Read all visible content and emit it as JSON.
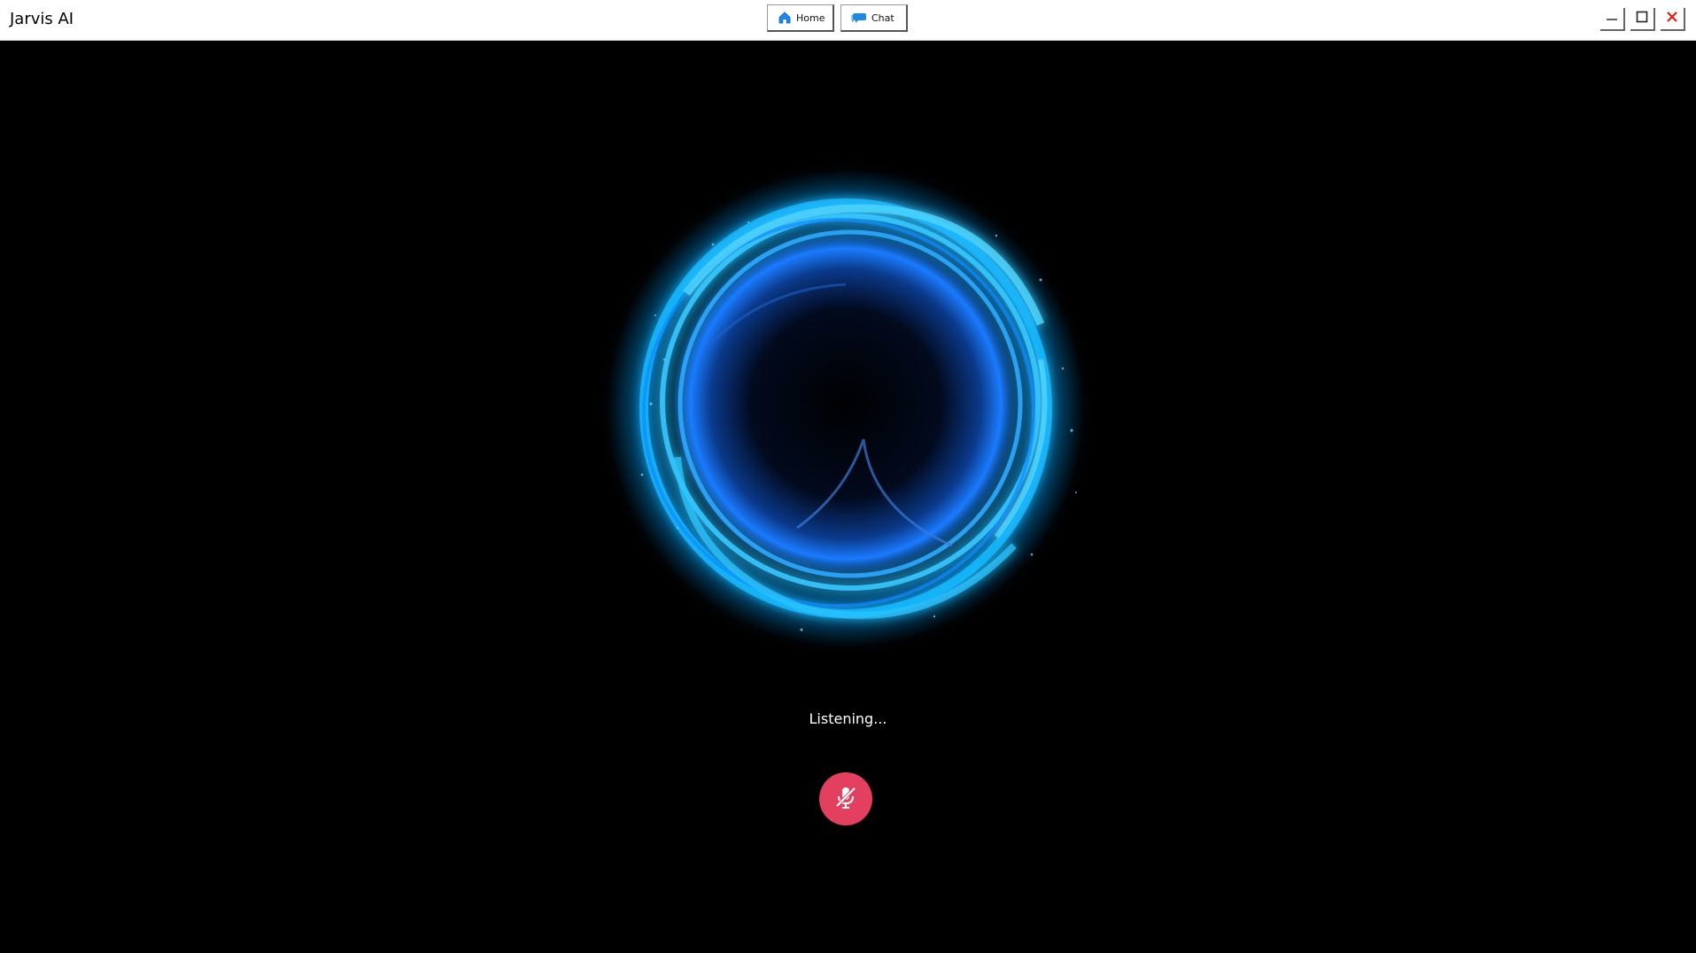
{
  "window": {
    "title": "Jarvis AI"
  },
  "nav": {
    "home_label": "Home",
    "chat_label": "Chat"
  },
  "icons": {
    "home": "home-icon",
    "chat": "chat-icon",
    "minimize": "minimize-icon",
    "maximize": "maximize-icon",
    "close": "close-icon",
    "mic": "mic-off-icon"
  },
  "main": {
    "status_text": "Listening..."
  },
  "colors": {
    "orb_primary": "#1a9cff",
    "orb_accent": "#3fd0ff",
    "mic_button": "#e3405f",
    "close_icon": "#e01a1a"
  }
}
